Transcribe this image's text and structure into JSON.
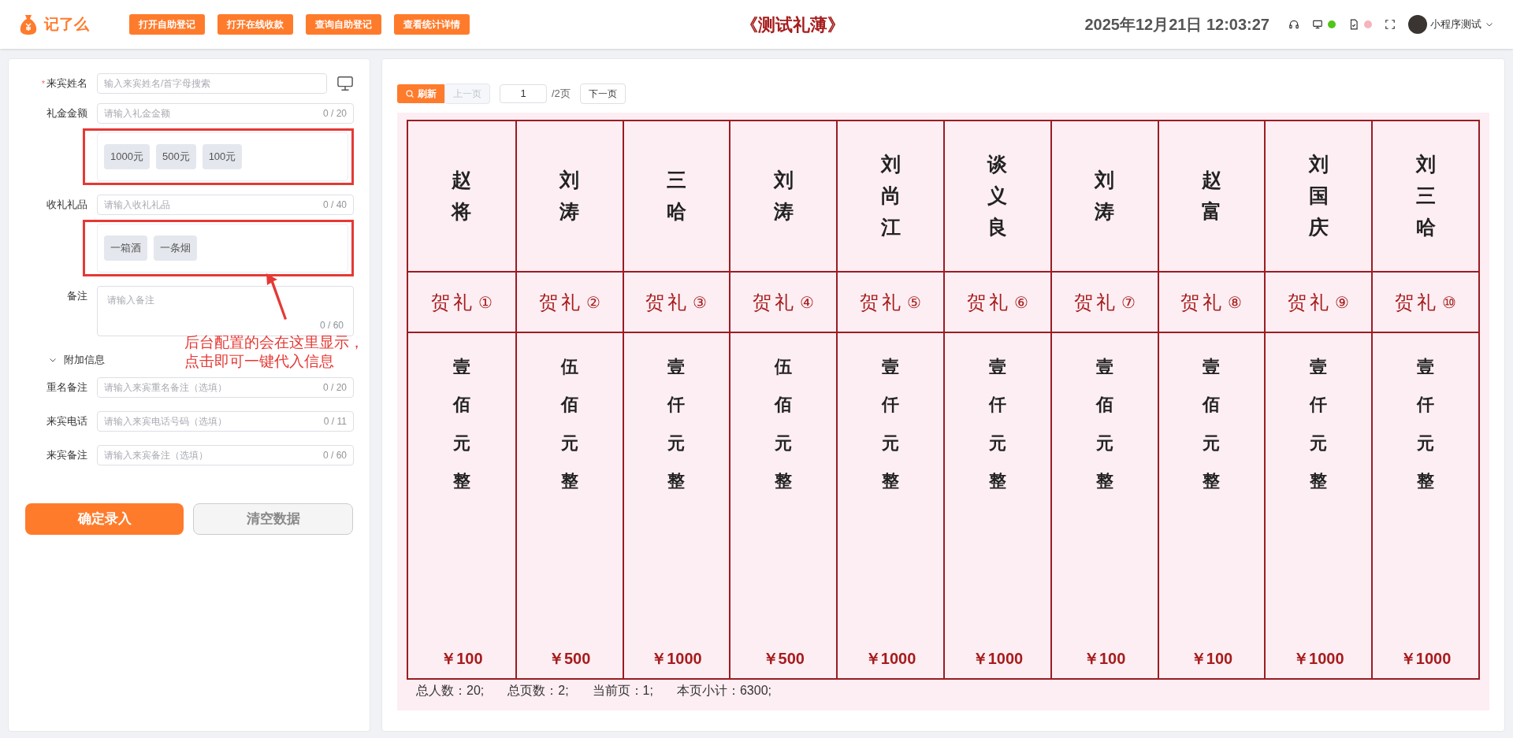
{
  "header": {
    "logo_text": "记了么",
    "actions": [
      "打开自助登记",
      "打开在线收款",
      "查询自助登记",
      "查看统计详情"
    ],
    "title": "《测试礼薄》",
    "datetime": "2025年12月21日 12:03:27",
    "status": [
      {
        "kind": "screen",
        "color": "#52c41a"
      },
      {
        "kind": "file",
        "color": "#f5b5bb"
      }
    ],
    "user": "小程序测试"
  },
  "form": {
    "required_mark": "*",
    "fields": [
      {
        "kind": "search",
        "label": "来宾姓名",
        "required": true,
        "placeholder": "输入来宾姓名/首字母搜索"
      },
      {
        "kind": "text",
        "label": "礼金金额",
        "required": false,
        "placeholder": "请输入礼金金额",
        "counter": "0 / 20",
        "chips": [
          "1000元",
          "500元",
          "100元"
        ]
      },
      {
        "kind": "text",
        "label": "收礼礼品",
        "required": false,
        "placeholder": "请输入收礼礼品",
        "counter": "0 / 40",
        "chips": [
          "一箱酒",
          "一条烟"
        ]
      },
      {
        "kind": "note",
        "label": "备注",
        "required": false,
        "placeholder": "请输入备注",
        "counter": "0 / 60"
      }
    ],
    "extra_toggle": {
      "label": "附加信息",
      "expanded": true
    },
    "extra_fields": [
      {
        "label": "重名备注",
        "placeholder": "请输入来宾重名备注（选填）",
        "counter": "0 / 20"
      },
      {
        "label": "来宾电话",
        "placeholder": "请输入来宾电话号码（选填）",
        "counter": "0 / 11"
      },
      {
        "label": "来宾备注",
        "placeholder": "请输入来宾备注（选填）",
        "counter": "0 / 60"
      }
    ],
    "buttons": [
      {
        "label": "确定录入",
        "kind": "primary"
      },
      {
        "label": "清空数据",
        "kind": "secondary"
      }
    ],
    "annotation": [
      "后台配置的会在这里显示，",
      "点击即可一键代入信息"
    ]
  },
  "pager": {
    "refresh": "刷新",
    "prev": {
      "label": "上一页",
      "disabled": true
    },
    "page": "1",
    "total": "/2页",
    "next": {
      "label": "下一页",
      "disabled": false
    }
  },
  "ledger": [
    {
      "name": "赵将",
      "gift": "贺礼",
      "index": "①",
      "amount_words": "壹佰元整",
      "amount": "￥100"
    },
    {
      "name": "刘涛",
      "gift": "贺礼",
      "index": "②",
      "amount_words": "伍佰元整",
      "amount": "￥500"
    },
    {
      "name": "三哈",
      "gift": "贺礼",
      "index": "③",
      "amount_words": "壹仟元整",
      "amount": "￥1000"
    },
    {
      "name": "刘涛",
      "gift": "贺礼",
      "index": "④",
      "amount_words": "伍佰元整",
      "amount": "￥500"
    },
    {
      "name": "刘尚江",
      "gift": "贺礼",
      "index": "⑤",
      "amount_words": "壹仟元整",
      "amount": "￥1000"
    },
    {
      "name": "谈义良",
      "gift": "贺礼",
      "index": "⑥",
      "amount_words": "壹仟元整",
      "amount": "￥1000"
    },
    {
      "name": "刘涛",
      "gift": "贺礼",
      "index": "⑦",
      "amount_words": "壹佰元整",
      "amount": "￥100"
    },
    {
      "name": "赵富",
      "gift": "贺礼",
      "index": "⑧",
      "amount_words": "壹佰元整",
      "amount": "￥100"
    },
    {
      "name": "刘国庆",
      "gift": "贺礼",
      "index": "⑨",
      "amount_words": "壹仟元整",
      "amount": "￥1000"
    },
    {
      "name": "刘三哈",
      "gift": "贺礼",
      "index": "⑩",
      "amount_words": "壹仟元整",
      "amount": "￥1000"
    }
  ],
  "summary": [
    "总人数：20;",
    "总页数：2;",
    "当前页：1;",
    "本页小计：6300;"
  ]
}
